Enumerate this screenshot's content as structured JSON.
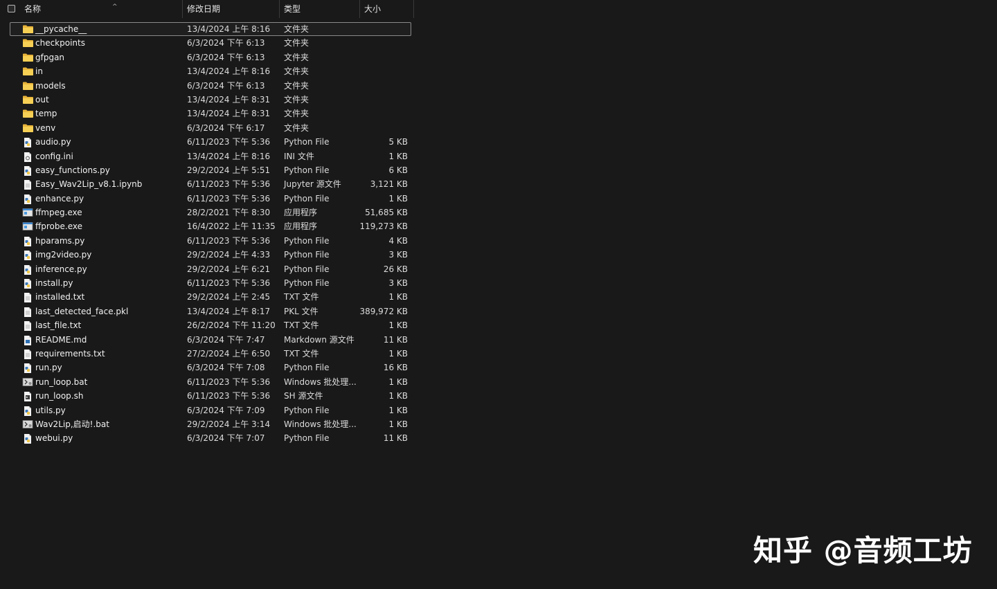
{
  "header": {
    "name": "名称",
    "date": "修改日期",
    "type": "类型",
    "size": "大小"
  },
  "colors": {
    "background": "#191919",
    "folder": "#f4c542",
    "text": "#f2f2f2"
  },
  "files": [
    {
      "icon": "folder-icon",
      "name": "__pycache__",
      "date": "13/4/2024 上午 8:16",
      "type": "文件夹",
      "size": ""
    },
    {
      "icon": "folder-icon",
      "name": "checkpoints",
      "date": "6/3/2024 下午 6:13",
      "type": "文件夹",
      "size": ""
    },
    {
      "icon": "folder-icon",
      "name": "gfpgan",
      "date": "6/3/2024 下午 6:13",
      "type": "文件夹",
      "size": ""
    },
    {
      "icon": "folder-icon",
      "name": "in",
      "date": "13/4/2024 上午 8:16",
      "type": "文件夹",
      "size": ""
    },
    {
      "icon": "folder-icon",
      "name": "models",
      "date": "6/3/2024 下午 6:13",
      "type": "文件夹",
      "size": ""
    },
    {
      "icon": "folder-icon",
      "name": "out",
      "date": "13/4/2024 上午 8:31",
      "type": "文件夹",
      "size": ""
    },
    {
      "icon": "folder-icon",
      "name": "temp",
      "date": "13/4/2024 上午 8:31",
      "type": "文件夹",
      "size": ""
    },
    {
      "icon": "folder-icon",
      "name": "venv",
      "date": "6/3/2024 下午 6:17",
      "type": "文件夹",
      "size": ""
    },
    {
      "icon": "python-file-icon",
      "name": "audio.py",
      "date": "6/11/2023 下午 5:36",
      "type": "Python File",
      "size": "5 KB"
    },
    {
      "icon": "config-file-icon",
      "name": "config.ini",
      "date": "13/4/2024 上午 8:16",
      "type": "INI 文件",
      "size": "1 KB"
    },
    {
      "icon": "python-file-icon",
      "name": "easy_functions.py",
      "date": "29/2/2024 上午 5:51",
      "type": "Python File",
      "size": "6 KB"
    },
    {
      "icon": "document-icon",
      "name": "Easy_Wav2Lip_v8.1.ipynb",
      "date": "6/11/2023 下午 5:36",
      "type": "Jupyter 源文件",
      "size": "3,121 KB"
    },
    {
      "icon": "python-file-icon",
      "name": "enhance.py",
      "date": "6/11/2023 下午 5:36",
      "type": "Python File",
      "size": "1 KB"
    },
    {
      "icon": "exe-file-icon",
      "name": "ffmpeg.exe",
      "date": "28/2/2021 下午 8:30",
      "type": "应用程序",
      "size": "51,685 KB"
    },
    {
      "icon": "exe-file-icon",
      "name": "ffprobe.exe",
      "date": "16/4/2022 上午 11:35",
      "type": "应用程序",
      "size": "119,273 KB"
    },
    {
      "icon": "python-file-icon",
      "name": "hparams.py",
      "date": "6/11/2023 下午 5:36",
      "type": "Python File",
      "size": "4 KB"
    },
    {
      "icon": "python-file-icon",
      "name": "img2video.py",
      "date": "29/2/2024 上午 4:33",
      "type": "Python File",
      "size": "3 KB"
    },
    {
      "icon": "python-file-icon",
      "name": "inference.py",
      "date": "29/2/2024 上午 6:21",
      "type": "Python File",
      "size": "26 KB"
    },
    {
      "icon": "python-file-icon",
      "name": "install.py",
      "date": "6/11/2023 下午 5:36",
      "type": "Python File",
      "size": "3 KB"
    },
    {
      "icon": "document-icon",
      "name": "installed.txt",
      "date": "29/2/2024 上午 2:45",
      "type": "TXT 文件",
      "size": "1 KB"
    },
    {
      "icon": "document-icon",
      "name": "last_detected_face.pkl",
      "date": "13/4/2024 上午 8:17",
      "type": "PKL 文件",
      "size": "389,972 KB"
    },
    {
      "icon": "document-icon",
      "name": "last_file.txt",
      "date": "26/2/2024 下午 11:20",
      "type": "TXT 文件",
      "size": "1 KB"
    },
    {
      "icon": "markdown-file-icon",
      "name": "README.md",
      "date": "6/3/2024 下午 7:47",
      "type": "Markdown 源文件",
      "size": "11 KB"
    },
    {
      "icon": "document-icon",
      "name": "requirements.txt",
      "date": "27/2/2024 上午 6:50",
      "type": "TXT 文件",
      "size": "1 KB"
    },
    {
      "icon": "python-file-icon",
      "name": "run.py",
      "date": "6/3/2024 下午 7:08",
      "type": "Python File",
      "size": "16 KB"
    },
    {
      "icon": "bat-file-icon",
      "name": "run_loop.bat",
      "date": "6/11/2023 下午 5:36",
      "type": "Windows 批处理...",
      "size": "1 KB"
    },
    {
      "icon": "sh-file-icon",
      "name": "run_loop.sh",
      "date": "6/11/2023 下午 5:36",
      "type": "SH 源文件",
      "size": "1 KB"
    },
    {
      "icon": "python-file-icon",
      "name": "utils.py",
      "date": "6/3/2024 下午 7:09",
      "type": "Python File",
      "size": "1 KB"
    },
    {
      "icon": "bat-file-icon",
      "name": "Wav2Lip,启动!.bat",
      "date": "29/2/2024 上午 3:14",
      "type": "Windows 批处理...",
      "size": "1 KB"
    },
    {
      "icon": "python-file-icon",
      "name": "webui.py",
      "date": "6/3/2024 下午 7:07",
      "type": "Python File",
      "size": "11 KB"
    }
  ],
  "watermark": "知乎 @音频工坊"
}
